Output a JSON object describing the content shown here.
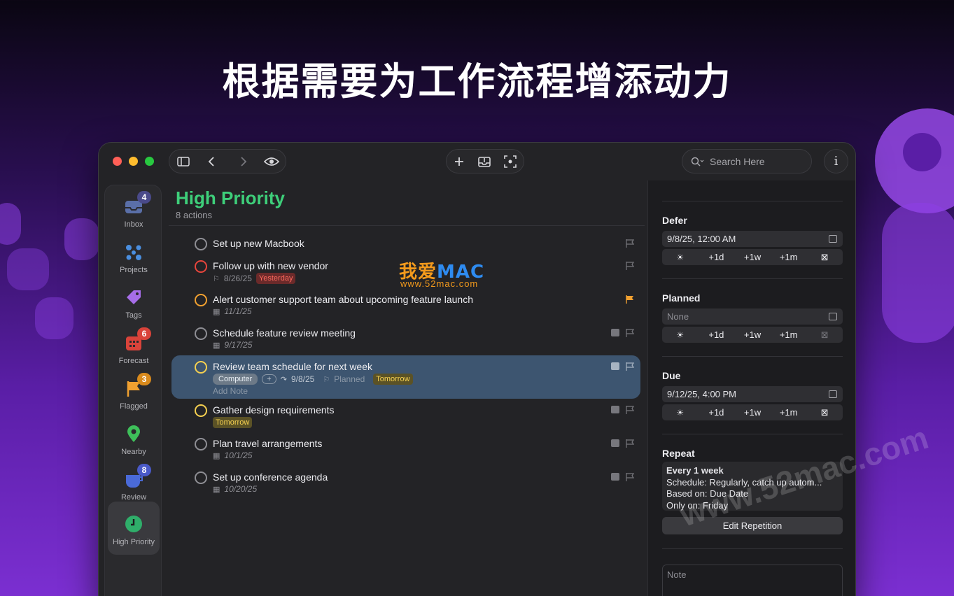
{
  "hero": {
    "title": "根据需要为工作流程增添动力"
  },
  "toolbar": {
    "search_placeholder": "Search Here",
    "info_label": "i"
  },
  "sidebar": {
    "items": [
      {
        "label": "Inbox",
        "badge": "4",
        "badge_color": "#4a4a8a",
        "icon": "inbox-icon"
      },
      {
        "label": "Projects",
        "badge": "",
        "icon": "projects-icon"
      },
      {
        "label": "Tags",
        "badge": "",
        "icon": "tag-icon"
      },
      {
        "label": "Forecast",
        "badge": "6",
        "badge_color": "#d9433a",
        "icon": "calendar-icon"
      },
      {
        "label": "Flagged",
        "badge": "3",
        "badge_color": "#d98a1c",
        "icon": "flag-icon"
      },
      {
        "label": "Nearby",
        "badge": "",
        "icon": "location-pin-icon"
      },
      {
        "label": "Review",
        "badge": "8",
        "badge_color": "#4a5ac8",
        "icon": "review-icon"
      },
      {
        "label": "High Priority",
        "badge": "",
        "icon": "clock-icon"
      }
    ]
  },
  "main": {
    "title": "High Priority",
    "subtitle": "8 actions",
    "tasks": [
      {
        "title": "Set up new Macbook"
      },
      {
        "title": "Follow up with new vendor",
        "planned": "8/26/25",
        "due_tag": "Yesterday"
      },
      {
        "title": "Alert customer support team about upcoming feature launch",
        "due": "11/1/25"
      },
      {
        "title": "Schedule feature review meeting",
        "due": "9/17/25"
      },
      {
        "title": "Review team schedule for next week",
        "context": "Computer",
        "add": "+",
        "defer": "9/8/25",
        "planned": "Planned",
        "due_tag": "Tomorrow",
        "add_note": "Add Note"
      },
      {
        "title": "Gather design requirements",
        "due_tag": "Tomorrow"
      },
      {
        "title": "Plan travel arrangements",
        "due": "10/1/25"
      },
      {
        "title": "Set up conference agenda",
        "due": "10/20/25"
      }
    ]
  },
  "inspector": {
    "defer": {
      "label": "Defer",
      "value": "9/8/25, 12:00 AM"
    },
    "planned": {
      "label": "Planned",
      "value": "None"
    },
    "due": {
      "label": "Due",
      "value": "9/12/25, 4:00 PM"
    },
    "quick": {
      "d": "+1d",
      "w": "+1w",
      "m": "+1m"
    },
    "repeat": {
      "label": "Repeat",
      "line1": "Every 1 week",
      "line2": "Schedule: Regularly, catch up autom...",
      "line3": "Based on: Due Date",
      "line4": "Only on: Friday",
      "edit": "Edit Repetition"
    },
    "note_placeholder": "Note"
  },
  "watermark": {
    "logo_a": "我爱",
    "logo_b": "MAC",
    "url": "www.52mac.com",
    "diag": "www.52mac.com"
  },
  "colors": {
    "accent_green": "#3ecf7a",
    "selection": "#3d5570",
    "flag_orange": "#f0a030",
    "red": "#ff5f57",
    "yellow": "#febc2e",
    "green": "#28c840"
  }
}
